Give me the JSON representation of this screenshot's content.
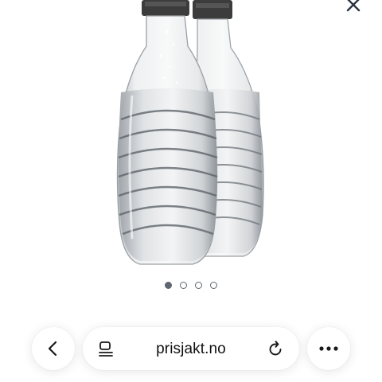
{
  "browser": {
    "url_display": "prisjakt.no"
  },
  "gallery": {
    "image_count": 4,
    "active_index": 0
  },
  "icons": {
    "close": "close-icon",
    "back": "chevron-left-icon",
    "reader": "reader-mode-icon",
    "reload": "reload-icon",
    "more": "more-icon"
  },
  "colors": {
    "dot": "#5f6670",
    "text": "#111111",
    "background": "#ffffff"
  }
}
